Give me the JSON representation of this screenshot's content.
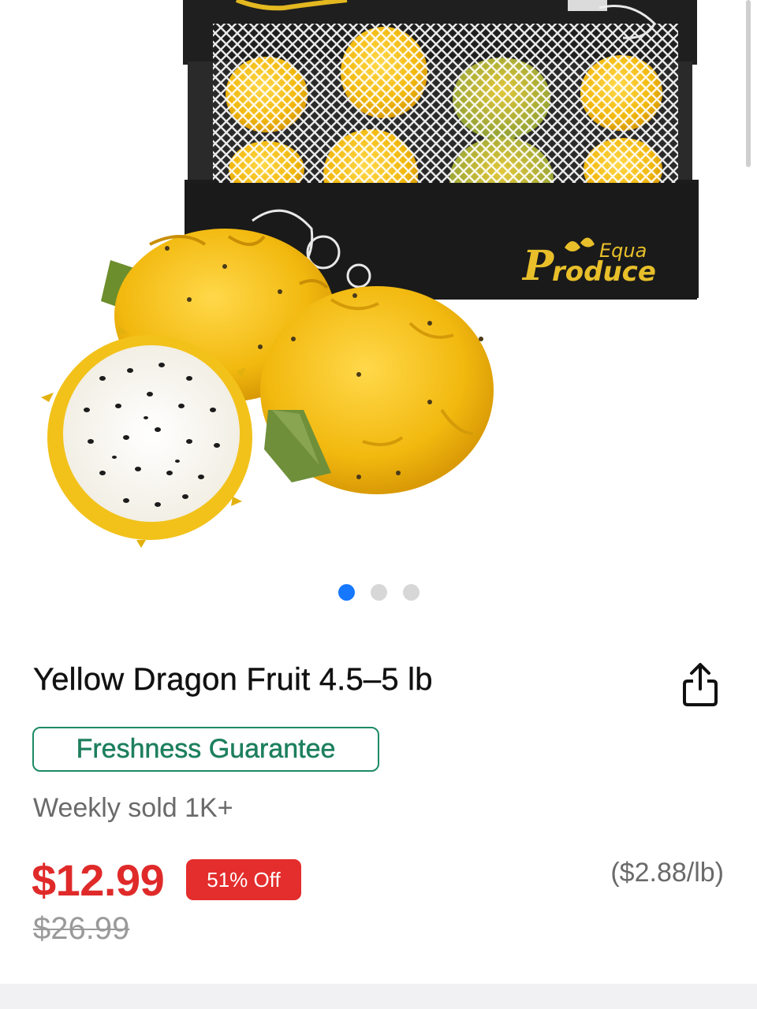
{
  "product": {
    "title": "Yellow Dragon Fruit 4.5–5 lb",
    "badge": "Freshness Guarantee",
    "weekly_sold": "Weekly sold 1K+",
    "price": "$12.99",
    "discount": "51% Off",
    "unit_price": "($2.88/lb)",
    "original_price": "$26.99"
  },
  "gallery": {
    "image_count": 3,
    "active_index": 0,
    "brand_logo_text": "Equa Produce"
  },
  "colors": {
    "price_red": "#e02a2a",
    "badge_green": "#1d8a66",
    "active_dot": "#1677ff",
    "fruit_yellow": "#f2c21b"
  },
  "icons": {
    "share": "share-icon"
  }
}
